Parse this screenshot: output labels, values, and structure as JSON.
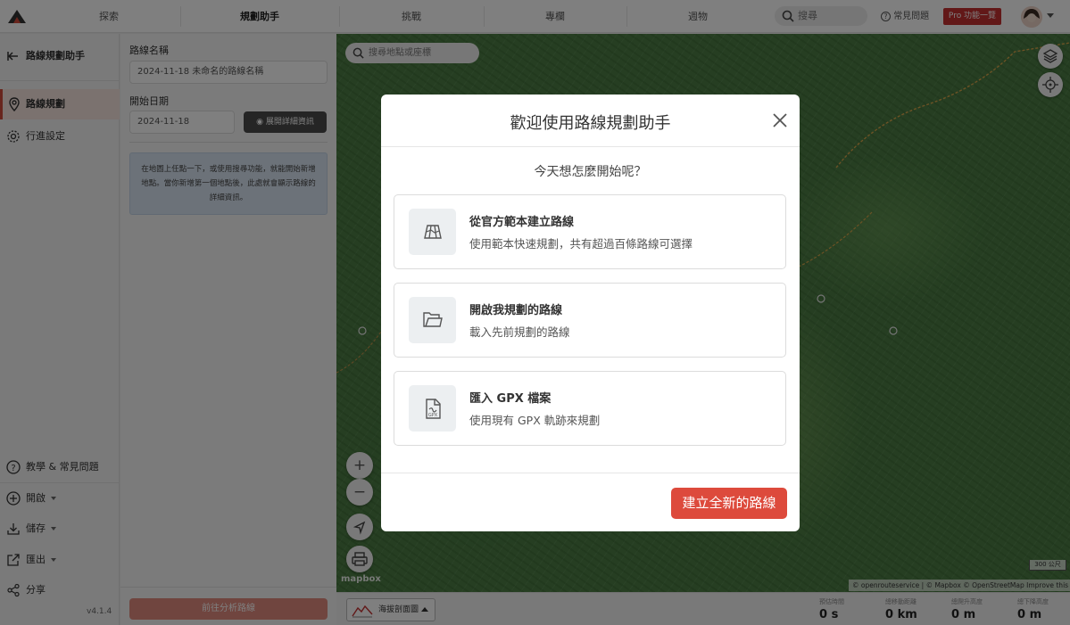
{
  "nav": {
    "items": [
      "探索",
      "規劃助手",
      "挑戰",
      "專欄",
      "週物"
    ],
    "search_placeholder": "搜尋",
    "faq": "常見問題",
    "pro": "Pro 功能一覽"
  },
  "sidebar": {
    "back_label": "路線規劃助手",
    "items": [
      {
        "label": "路線規劃",
        "icon": "map-pin-icon",
        "active": true
      },
      {
        "label": "行進設定",
        "icon": "gear-icon",
        "active": false
      }
    ],
    "bottom_items": [
      {
        "label": "教學 & 常見問題",
        "icon": "help-icon"
      },
      {
        "label": "開啟",
        "icon": "plus-circle-icon"
      },
      {
        "label": "儲存",
        "icon": "download-icon"
      },
      {
        "label": "匯出",
        "icon": "export-icon"
      },
      {
        "label": "分享",
        "icon": "share-icon"
      }
    ],
    "version": "v4.1.4"
  },
  "form": {
    "route_name_label": "路線名稱",
    "route_name_value": "2024-11-18 未命名的路線名稱",
    "start_date_label": "開始日期",
    "start_date_value": "2024-11-18",
    "detail_button": "展開詳細資訊",
    "hint": "在地圖上任點一下，或使用搜尋功能，就能開始新增地點。當你新增第一個地點後，此處就會顯示路線的詳細資訊。",
    "next_button": "前往分析路線"
  },
  "map": {
    "search_placeholder": "搜尋地點或座標",
    "attribution": "© openrouteservice | © Mapbox © OpenStreetMap Improve this map",
    "scale": "300 公尺",
    "logo": "mapbox"
  },
  "bottom": {
    "elevation_button": "海拔剖面圖",
    "stats": [
      {
        "label": "預估時間",
        "value": "0 s"
      },
      {
        "label": "總移動距離",
        "value": "0 km"
      },
      {
        "label": "總爬升高度",
        "value": "0 m"
      },
      {
        "label": "總下降高度",
        "value": "0 m"
      }
    ]
  },
  "modal": {
    "title": "歡迎使用路線規劃助手",
    "subtitle": "今天想怎麼開始呢？",
    "options": [
      {
        "title": "從官方範本建立路線",
        "desc": "使用範本快速規劃，共有超過百條路線可選擇",
        "icon": "map-template-icon"
      },
      {
        "title": "開啟我規劃的路線",
        "desc": "載入先前規劃的路線",
        "icon": "folder-icon"
      },
      {
        "title": "匯入 GPX 檔案",
        "desc": "使用現有 GPX 軌跡來規劃",
        "icon": "gpx-file-icon"
      }
    ],
    "create_button": "建立全新的路線"
  },
  "colors": {
    "accent": "#dd4a3c",
    "pro": "#c53030",
    "active_bg": "#f7e4df"
  }
}
